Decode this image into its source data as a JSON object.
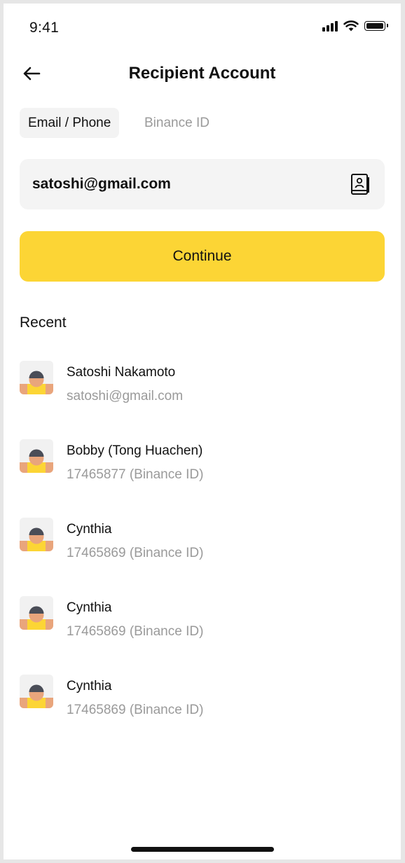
{
  "status_bar": {
    "time": "9:41"
  },
  "header": {
    "title": "Recipient Account",
    "back_icon": "arrow-left-icon"
  },
  "tabs": [
    {
      "label": "Email / Phone",
      "active": true
    },
    {
      "label": "Binance ID",
      "active": false
    }
  ],
  "recipient_input": {
    "value": "satoshi@gmail.com",
    "icon": "address-book-icon"
  },
  "continue_button": {
    "label": "Continue",
    "color": "#FCD535"
  },
  "recent": {
    "title": "Recent",
    "items": [
      {
        "name": "Satoshi Nakamoto",
        "sub": "satoshi@gmail.com"
      },
      {
        "name": "Bobby (Tong Huachen)",
        "sub": "17465877 (Binance ID)"
      },
      {
        "name": "Cynthia",
        "sub": "17465869 (Binance ID)"
      },
      {
        "name": "Cynthia",
        "sub": "17465869 (Binance ID)"
      },
      {
        "name": "Cynthia",
        "sub": "17465869 (Binance ID)"
      }
    ]
  },
  "colors": {
    "accent": "#FCD535",
    "text_primary": "#111111",
    "text_secondary": "#9A9A9A",
    "surface": "#F4F4F4"
  }
}
